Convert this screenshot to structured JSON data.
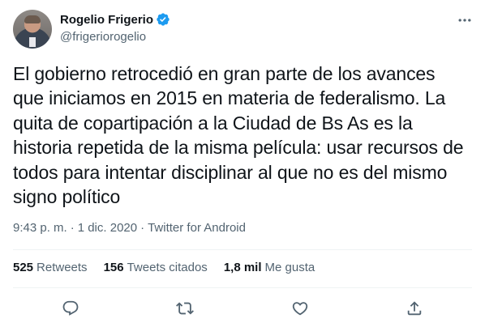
{
  "author": {
    "display_name": "Rogelio Frigerio",
    "handle": "@frigeriorogelio",
    "verified": true
  },
  "tweet": {
    "text": "El gobierno retrocedió en gran parte de los avances\nque iniciamos en 2015 en materia de federalismo. La\nquita de copartipación a la Ciudad de Bs As es la\nhistoria repetida de la misma película: usar recursos de\ntodos para intentar disciplinar al que no es del mismo\nsigno político",
    "time": "9:43 p. m.",
    "separator": "·",
    "date": "1 dic. 2020",
    "separator2": "·",
    "source": "Twitter for Android"
  },
  "stats": {
    "retweets_count": "525",
    "retweets_label": "Retweets",
    "quotes_count": "156",
    "quotes_label": "Tweets citados",
    "likes_count": "1,8 mil",
    "likes_label": "Me gusta"
  },
  "colors": {
    "text": "#0f1419",
    "secondary": "#536471",
    "verified": "#1d9bf0"
  },
  "icons": [
    "verified-badge-icon",
    "more-icon",
    "reply-icon",
    "retweet-icon",
    "like-icon",
    "share-icon"
  ]
}
